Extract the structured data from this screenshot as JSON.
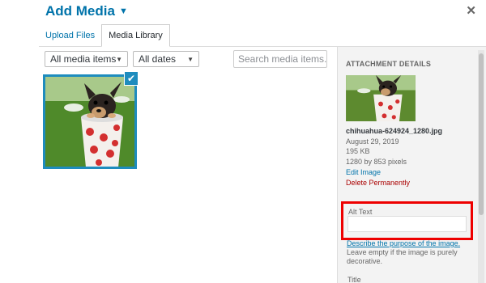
{
  "header": {
    "title": "Add Media",
    "close_icon": "close-icon"
  },
  "tabs": [
    {
      "label": "Upload Files",
      "active": false
    },
    {
      "label": "Media Library",
      "active": true
    }
  ],
  "filters": {
    "media_type": "All media items",
    "dates": "All dates",
    "search_placeholder": "Search media items..."
  },
  "attachment": {
    "selected": true
  },
  "details": {
    "heading": "ATTACHMENT DETAILS",
    "filename": "chihuahua-624924_1280.jpg",
    "date": "August 29, 2019",
    "size": "195 KB",
    "dimensions": "1280 by 853 pixels",
    "edit_link": "Edit Image",
    "delete_link": "Delete Permanently",
    "alt_label": "Alt Text",
    "alt_value": "",
    "describe_link": "Describe the purpose of the image.",
    "hint": "Leave empty if the image is purely decorative.",
    "title_label": "Title"
  },
  "colors": {
    "accent": "#0073aa",
    "selection": "#1e8cbe",
    "delete": "#aa0000",
    "highlight": "#ee0000"
  }
}
